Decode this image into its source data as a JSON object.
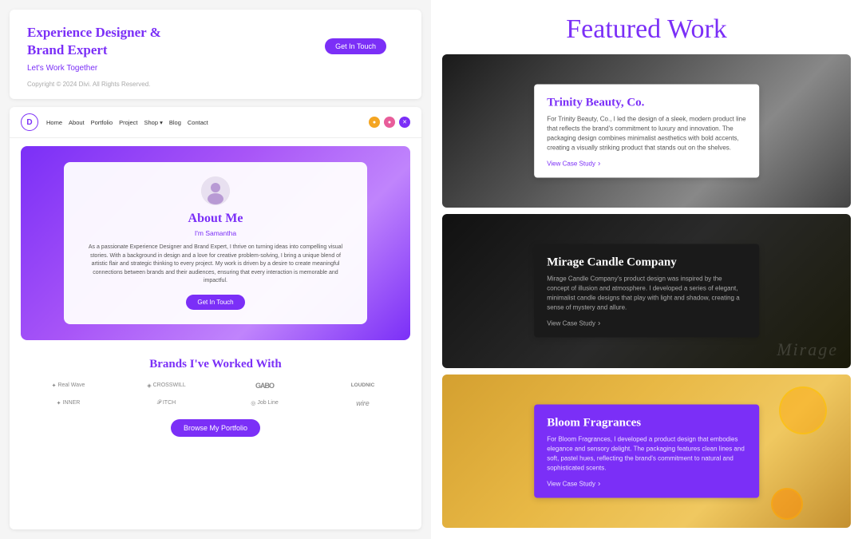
{
  "left": {
    "top_card": {
      "title": "Experience Designer &\nBrand Expert",
      "subtitle": "Let's Work Together",
      "cta_label": "Get In Touch",
      "copyright": "Copyright © 2024 Divi. All Rights Reserved."
    },
    "nav": {
      "logo": "D",
      "links": [
        "Home",
        "About",
        "Portfolio",
        "Project",
        "Shop ▾",
        "Blog",
        "Contact"
      ]
    },
    "hero": {
      "title": "About Me",
      "subtitle": "I'm Samantha",
      "description": "As a passionate Experience Designer and Brand Expert, I thrive on turning ideas into compelling visual stories. With a background in design and a love for creative problem-solving, I bring a unique blend of artistic flair and strategic thinking to every project. My work is driven by a desire to create meaningful connections between brands and their audiences, ensuring that every interaction is memorable and impactful.",
      "btn_label": "Get In Touch"
    },
    "brands": {
      "title": "Brands I've Worked With",
      "logos": [
        "Real Wave",
        "CROSSWILL",
        "GABO",
        "LOUDNIC",
        "INNER",
        "PITCH",
        "Job Line",
        "wire"
      ],
      "btn_label": "Browse My Portfolio"
    }
  },
  "right": {
    "section_title": "Featured Work",
    "cards": [
      {
        "id": "trinity",
        "company": "Trinity Beauty, Co.",
        "description": "For Trinity Beauty, Co., I led the design of a sleek, modern product line that reflects the brand's commitment to luxury and innovation. The packaging design combines minimalist aesthetics with bold accents, creating a visually striking product that stands out on the shelves.",
        "link_label": "View Case Study",
        "style": "light",
        "bg": "fabric"
      },
      {
        "id": "mirage",
        "company": "Mirage Candle Company",
        "description": "Mirage Candle Company's product design was inspired by the concept of illusion and atmosphere. I developed a series of elegant, minimalist candle designs that play with light and shadow, creating a sense of mystery and allure.",
        "link_label": "View Case Study",
        "style": "dark",
        "bg": "candle"
      },
      {
        "id": "bloom",
        "company": "Bloom Fragrances",
        "description": "For Bloom Fragrances, I developed a product design that embodies elegance and sensory delight. The packaging features clean lines and soft, pastel hues, reflecting the brand's commitment to natural and sophisticated scents.",
        "link_label": "View Case Study",
        "style": "purple",
        "bg": "citrus"
      }
    ]
  }
}
